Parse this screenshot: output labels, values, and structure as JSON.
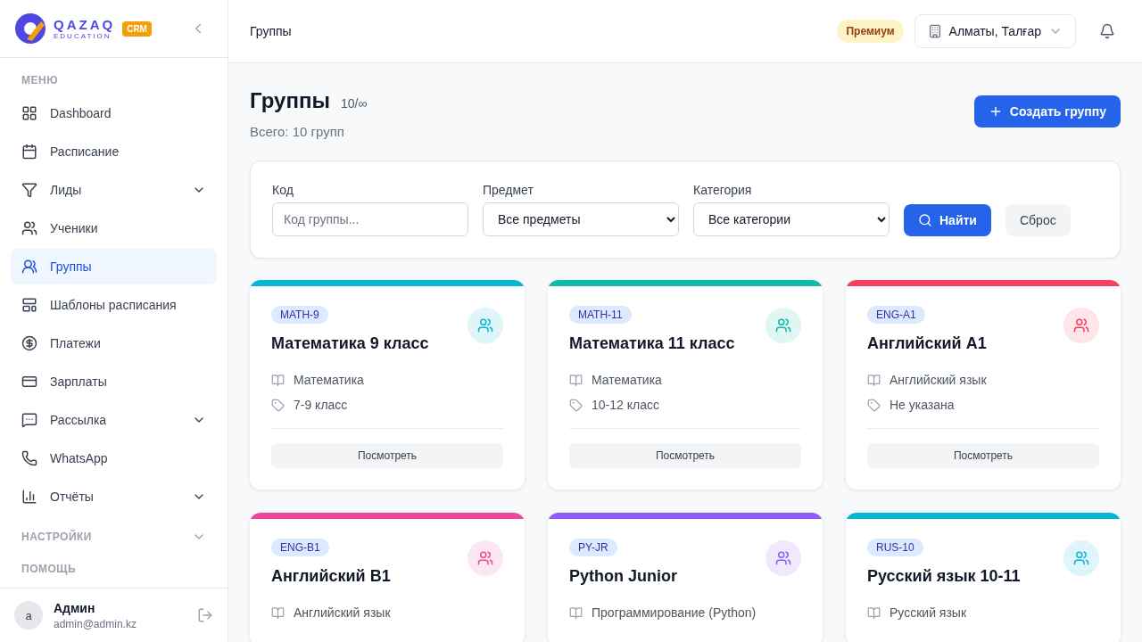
{
  "logo": {
    "name": "QAZAQ",
    "tagline": "EDUCATION",
    "badge": "CRM"
  },
  "sidebar": {
    "sections": [
      {
        "title": "МЕНЮ",
        "items": [
          {
            "label": "Dashboard",
            "selected": false,
            "expandable": false
          },
          {
            "label": "Расписание",
            "selected": false,
            "expandable": false
          },
          {
            "label": "Лиды",
            "selected": false,
            "expandable": true
          },
          {
            "label": "Ученики",
            "selected": false,
            "expandable": false
          },
          {
            "label": "Группы",
            "selected": true,
            "expandable": false
          },
          {
            "label": "Шаблоны расписания",
            "selected": false,
            "expandable": false
          },
          {
            "label": "Платежи",
            "selected": false,
            "expandable": false
          },
          {
            "label": "Зарплаты",
            "selected": false,
            "expandable": false
          },
          {
            "label": "Рассылка",
            "selected": false,
            "expandable": true
          },
          {
            "label": "WhatsApp",
            "selected": false,
            "expandable": false
          },
          {
            "label": "Отчёты",
            "selected": false,
            "expandable": true
          }
        ]
      },
      {
        "title": "НАСТРОЙКИ",
        "expandable": true
      },
      {
        "title": "ПОМОЩЬ"
      }
    ]
  },
  "user": {
    "initial": "a",
    "name": "Админ",
    "email": "admin@admin.kz"
  },
  "header": {
    "breadcrumb": "Группы",
    "plan": "Премиум",
    "branch": "Алматы, Талғар"
  },
  "page": {
    "title": "Группы",
    "quota": "10/∞",
    "subtitle": "Всего: 10 групп",
    "create_button": "Создать группу"
  },
  "filters": {
    "fields": [
      {
        "kind": "input",
        "label": "Код",
        "placeholder": "Код группы..."
      },
      {
        "kind": "select",
        "label": "Предмет",
        "value": "Все предметы"
      },
      {
        "kind": "select",
        "label": "Категория",
        "value": "Все категории"
      }
    ],
    "search_button": "Найти",
    "reset_button": "Сброс"
  },
  "groups": [
    {
      "code": "MATH-9",
      "title": "Математика 9 класс",
      "subject": "Математика",
      "category": "7-9 класс",
      "action": "Посмотреть",
      "color": "#06b6d4"
    },
    {
      "code": "MATH-11",
      "title": "Математика 11 класс",
      "subject": "Математика",
      "category": "10-12 класс",
      "action": "Посмотреть",
      "color": "#14b8a6"
    },
    {
      "code": "ENG-A1",
      "title": "Английский A1",
      "subject": "Английский язык",
      "category": "Не указана",
      "action": "Посмотреть",
      "color": "#f43f5e"
    },
    {
      "code": "ENG-B1",
      "title": "Английский B1",
      "subject": "Английский язык",
      "color": "#ec4899"
    },
    {
      "code": "PY-JR",
      "title": "Python Junior",
      "subject": "Программирование (Python)",
      "color": "#8b5cf6"
    },
    {
      "code": "RUS-10",
      "title": "Русский язык 10-11",
      "subject": "Русский язык",
      "color": "#06b6d4"
    }
  ]
}
